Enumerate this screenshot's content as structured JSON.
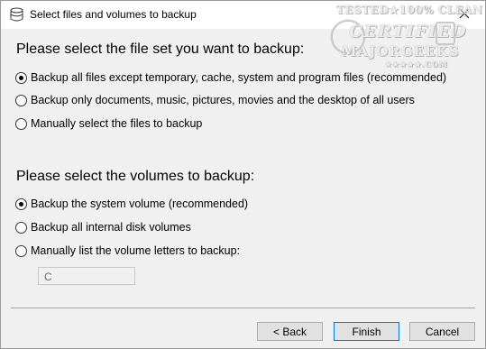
{
  "window": {
    "title": "Select files and volumes to backup",
    "icon": "database-icon",
    "close_icon": "close-icon"
  },
  "watermark": {
    "line1": "TESTED★100% CLEAN",
    "line2": "CERTIFIED",
    "line3": "MAJORGEEKS",
    "stars": "★★★★★.COM"
  },
  "file_set": {
    "heading": "Please select the file set you want to backup:",
    "options": [
      {
        "label": "Backup all files except temporary, cache, system and program files (recommended)",
        "checked": true
      },
      {
        "label": "Backup only documents, music, pictures, movies and the desktop of all users",
        "checked": false
      },
      {
        "label": "Manually select the files to backup",
        "checked": false
      }
    ]
  },
  "volumes": {
    "heading": "Please select the volumes to backup:",
    "options": [
      {
        "label": "Backup the system volume (recommended)",
        "checked": true
      },
      {
        "label": "Backup all internal disk volumes",
        "checked": false
      },
      {
        "label": "Manually list the volume letters to backup:",
        "checked": false
      }
    ],
    "letters_value": "C"
  },
  "buttons": {
    "back": "< Back",
    "finish": "Finish",
    "cancel": "Cancel"
  }
}
